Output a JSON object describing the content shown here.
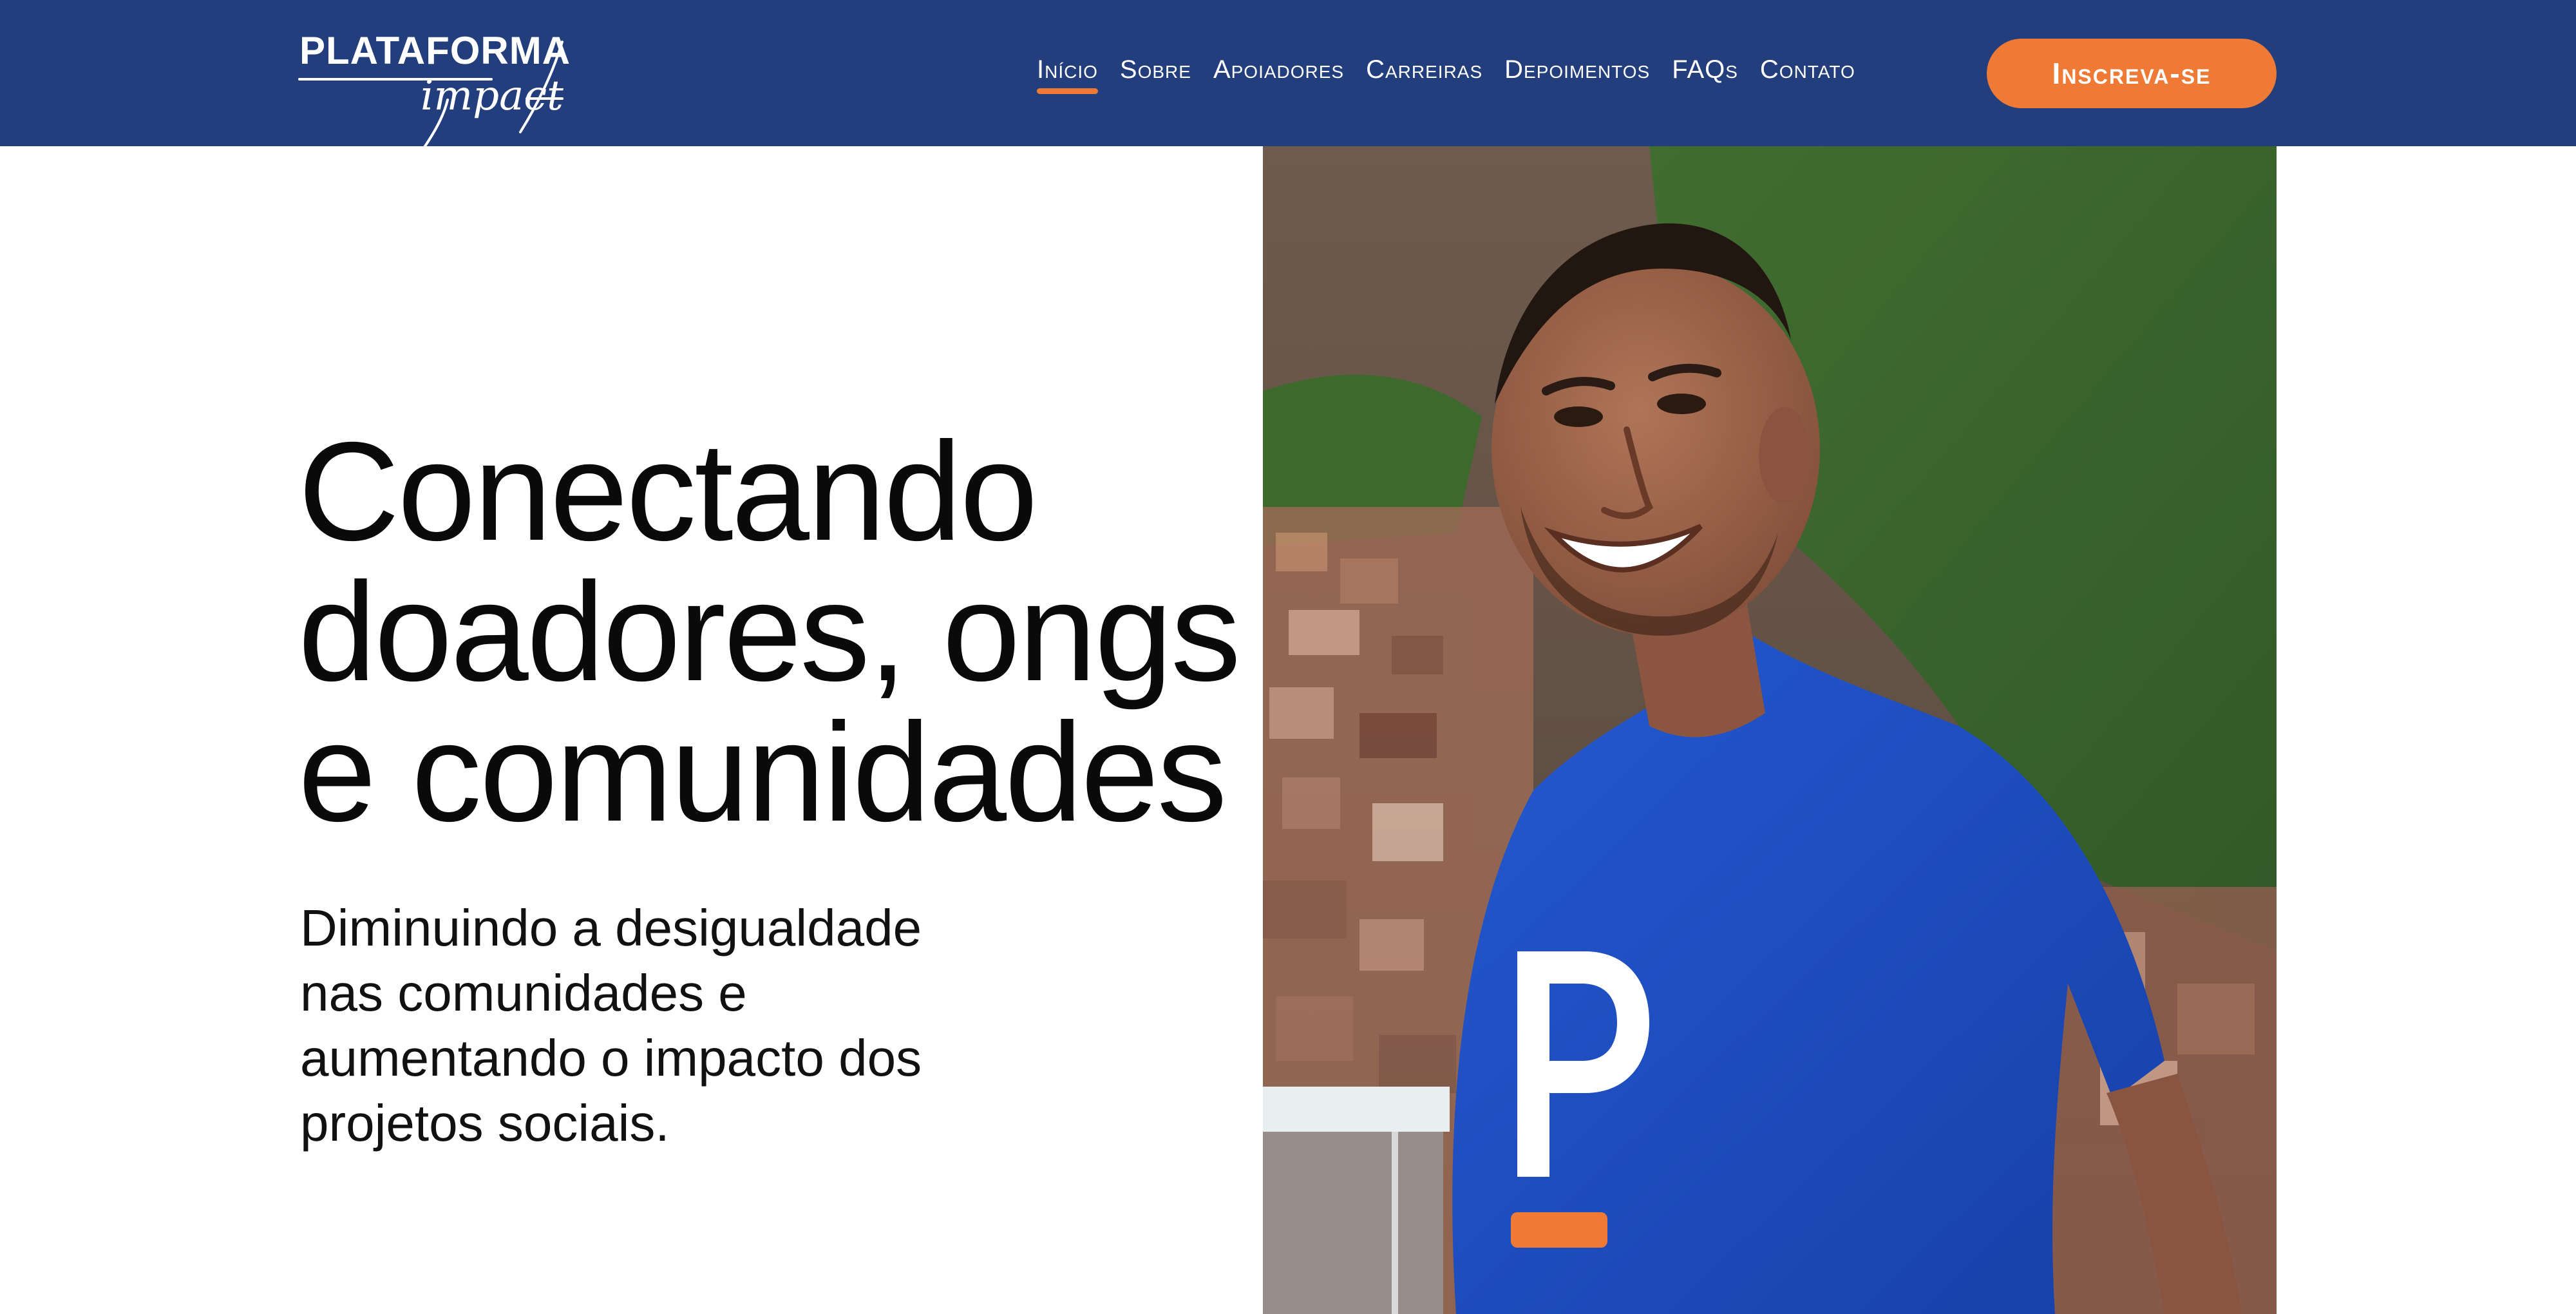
{
  "brand": {
    "logo_word": "PLATAFORMA",
    "logo_script": "impact",
    "colors": {
      "navy": "#233e7c",
      "orange": "#ee7a35",
      "white": "#ffffff",
      "shirt_blue": "#1f4fc4"
    }
  },
  "nav": {
    "items": [
      {
        "label": "Início",
        "active": true
      },
      {
        "label": "Sobre",
        "active": false
      },
      {
        "label": "Apoiadores",
        "active": false
      },
      {
        "label": "Carreiras",
        "active": false
      },
      {
        "label": "Depoimentos",
        "active": false
      },
      {
        "label": "FAQs",
        "active": false
      },
      {
        "label": "Contato",
        "active": false
      }
    ],
    "cta_label": "Inscreva-se"
  },
  "hero": {
    "title_lines": [
      "Conectando",
      "doadores, ongs",
      "e comunidades"
    ],
    "subtitle_lines": [
      "Diminuindo a desigualdade",
      "nas comunidades e",
      "aumentando o impacto dos",
      "projetos sociais."
    ],
    "photo": {
      "subject": "smiling young man in blue t-shirt with P logo, hillside community behind"
    }
  }
}
